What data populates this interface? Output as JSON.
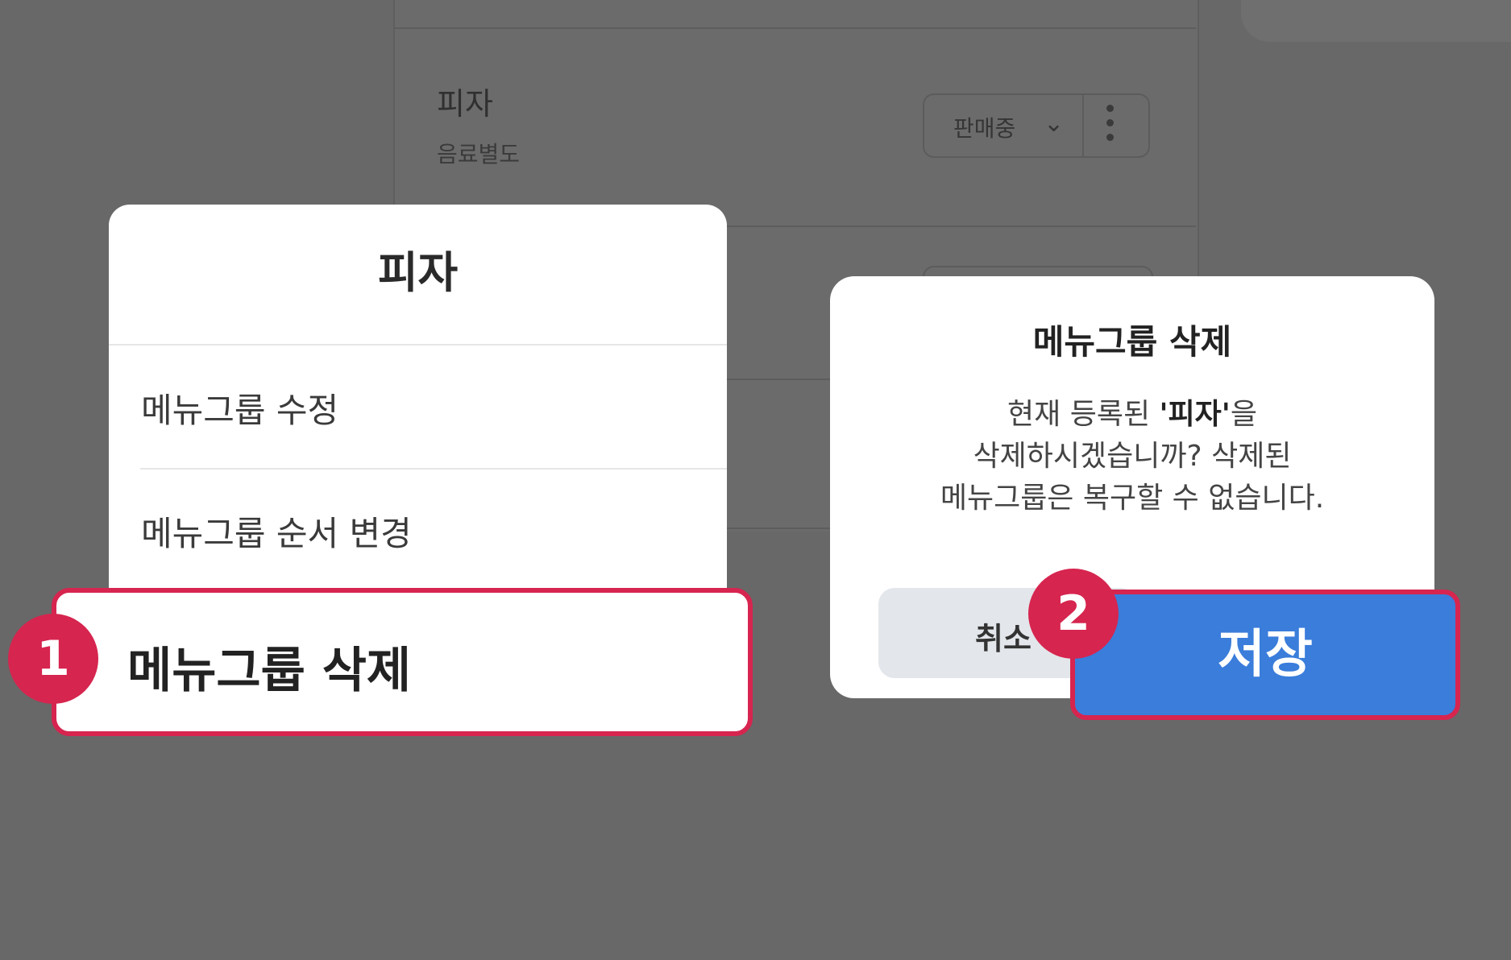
{
  "background": {
    "item_name": "피자",
    "item_sub": "음료별도",
    "status_select_value": "판매중"
  },
  "sheet": {
    "title": "피자",
    "items": [
      "메뉴그룹 수정",
      "메뉴그룹 순서 변경",
      "메뉴그룹 삭제"
    ]
  },
  "dialog": {
    "title": "메뉴그룹 삭제",
    "msg_prefix": "현재 등록된 ",
    "msg_name": "'피자'",
    "msg_suffix": "을",
    "msg_line2": "삭제하시겠습니까? 삭제된",
    "msg_line3": "메뉴그룹은 복구할 수 없습니다.",
    "cancel_label": "취소",
    "save_label": "저장"
  },
  "badges": [
    "1",
    "2"
  ],
  "colors": {
    "overlay": "#686868",
    "highlight": "#d6254f",
    "primary": "#3a7ddb",
    "cancel_bg": "#e3e6ea"
  },
  "icons": [
    "chevron-down-icon",
    "more-vertical-icon"
  ]
}
